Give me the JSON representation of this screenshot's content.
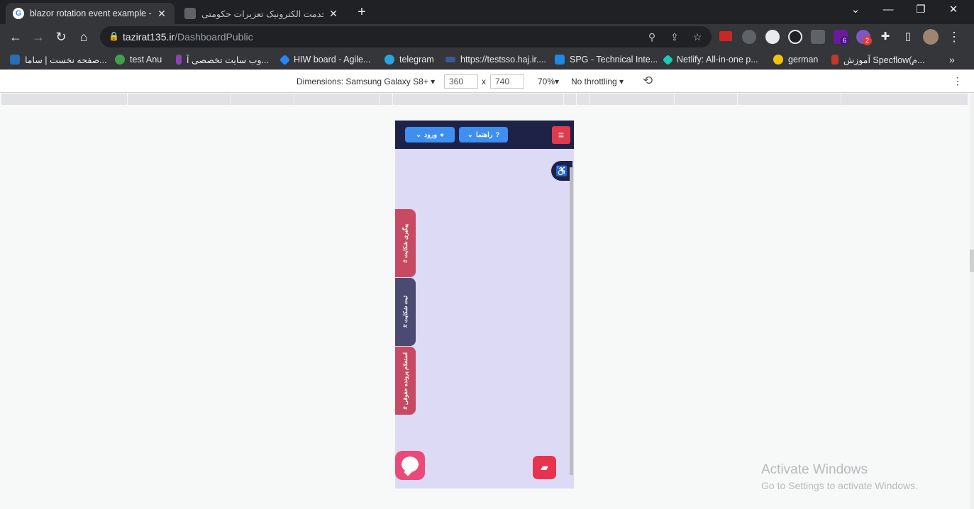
{
  "tabs": [
    {
      "title": "blazor rotation event example - G",
      "active": true,
      "favicon": "google-icon"
    },
    {
      "title": "میز خدمت الکترونیک تعزیرات حکومتی",
      "active": false,
      "favicon": "site-icon"
    }
  ],
  "window_controls": {
    "minimize": "—",
    "restore": "❐",
    "close": "✕",
    "tab_menu": "⌄"
  },
  "address_bar": {
    "domain": "tazirat135.ir",
    "path": "/DashboardPublic"
  },
  "extensions_badges": {
    "ext_a": "6",
    "ext_b": "2"
  },
  "bookmarks": [
    {
      "label": "صفحه نخست | ساما...",
      "icon": "sama-icon",
      "color": "#2a6db5"
    },
    {
      "label": "test Anu",
      "icon": "globe-icon",
      "color": "#43a047"
    },
    {
      "label": "وب سایت تخصصی آ...",
      "icon": "bars-icon",
      "color": "#8e44ad"
    },
    {
      "label": "HIW board - Agile...",
      "icon": "jira-icon",
      "color": "#2684ff"
    },
    {
      "label": "telegram",
      "icon": "telegram-icon",
      "color": "#2aa3df"
    },
    {
      "label": "https://testsso.haj.ir....",
      "icon": "sso-icon",
      "color": "#3b5998"
    },
    {
      "label": "SPG - Technical Inte...",
      "icon": "azure-icon",
      "color": "#1e88e5"
    },
    {
      "label": "Netlify: All-in-one p...",
      "icon": "netlify-icon",
      "color": "#20c6b7"
    },
    {
      "label": "german",
      "icon": "smile-icon",
      "color": "#f4c20d"
    },
    {
      "label": "آموزش Specflow(م...",
      "icon": "specflow-icon",
      "color": "#c0392b"
    }
  ],
  "devtools": {
    "dimensions_label": "Dimensions: Samsung Galaxy S8+",
    "width": "360",
    "height": "740",
    "times": "x",
    "zoom": "70%",
    "throttling": "No throttling"
  },
  "site": {
    "login_label": "ورود",
    "help_label": "راهنما",
    "side_tabs": [
      {
        "label": "# پیگیری شکایت",
        "color": "#c84a62"
      },
      {
        "label": "# ثبت شکایت",
        "color": "#4b4b72"
      },
      {
        "label": "# استعلام پرونده حقوقی",
        "color": "#c84a62"
      }
    ]
  },
  "watermark": {
    "title": "Activate Windows",
    "subtitle": "Go to Settings to activate Windows."
  }
}
